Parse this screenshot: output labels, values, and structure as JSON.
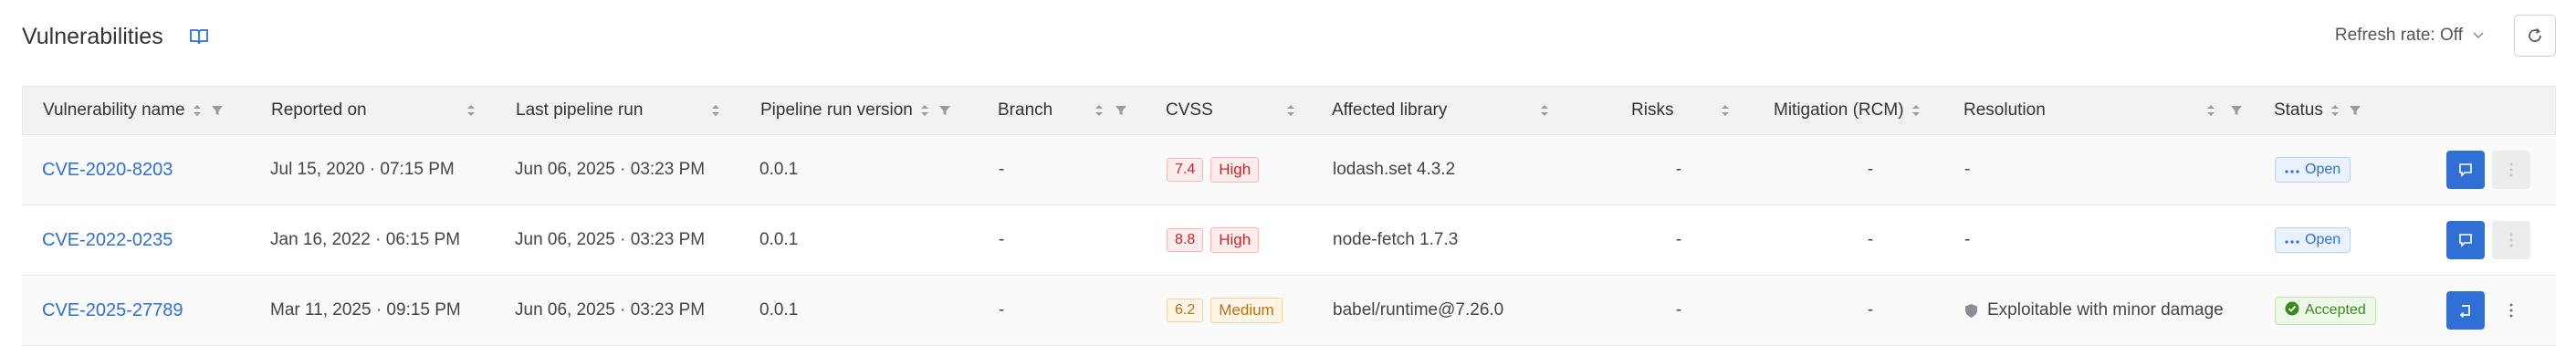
{
  "header": {
    "title": "Vulnerabilities",
    "refresh_label": "Refresh rate: Off"
  },
  "columns": [
    "Vulnerability name",
    "Reported on",
    "Last pipeline run",
    "Pipeline run version",
    "Branch",
    "CVSS",
    "Affected library",
    "Risks",
    "Mitigation (RCM)",
    "Resolution",
    "Status"
  ],
  "rows": [
    {
      "name": "CVE-2020-8203",
      "reported_on": "Jul 15, 2020 · 07:15 PM",
      "last_run": "Jun 06, 2025 · 03:23 PM",
      "version": "0.0.1",
      "branch": "-",
      "cvss_score": "7.4",
      "severity": "High",
      "library": "lodash.set 4.3.2",
      "risks": "-",
      "mitigation": "-",
      "resolution": "-",
      "status": "Open"
    },
    {
      "name": "CVE-2022-0235",
      "reported_on": "Jan 16, 2022 · 06:15 PM",
      "last_run": "Jun 06, 2025 · 03:23 PM",
      "version": "0.0.1",
      "branch": "-",
      "cvss_score": "8.8",
      "severity": "High",
      "library": "node-fetch 1.7.3",
      "risks": "-",
      "mitigation": "-",
      "resolution": "-",
      "status": "Open"
    },
    {
      "name": "CVE-2025-27789",
      "reported_on": "Mar 11, 2025 · 09:15 PM",
      "last_run": "Jun 06, 2025 · 03:23 PM",
      "version": "0.0.1",
      "branch": "-",
      "cvss_score": "6.2",
      "severity": "Medium",
      "library": "babel/runtime@7.26.0",
      "risks": "-",
      "mitigation": "-",
      "resolution": "Exploitable with minor damage",
      "status": "Accepted"
    }
  ],
  "colors": {
    "link": "#2f6fd6",
    "primary_button": "#2f6fd6",
    "high_text": "#c62828",
    "high_bg": "#fdecec",
    "high_border": "#f2b8b8",
    "medium_text": "#b8730a",
    "medium_bg": "#fff5e6",
    "medium_border": "#f5d3a1",
    "open_text": "#2f6fd6",
    "open_bg": "#eaf2ff",
    "open_border": "#b9d3f7",
    "accepted_text": "#3a8a1f",
    "accepted_bg": "#eef8e8",
    "accepted_border": "#bfe2ad"
  },
  "icons": {
    "book": "book-icon",
    "refresh": "refresh-icon",
    "chevron": "chevron-down-icon",
    "sort": "sort-icon",
    "filter": "filter-icon",
    "open_dots": "ellipsis-icon",
    "accepted_check": "check-circle-icon",
    "shield": "shield-icon",
    "comment": "comment-icon",
    "undo": "undo-icon",
    "more": "more-vertical-icon"
  }
}
